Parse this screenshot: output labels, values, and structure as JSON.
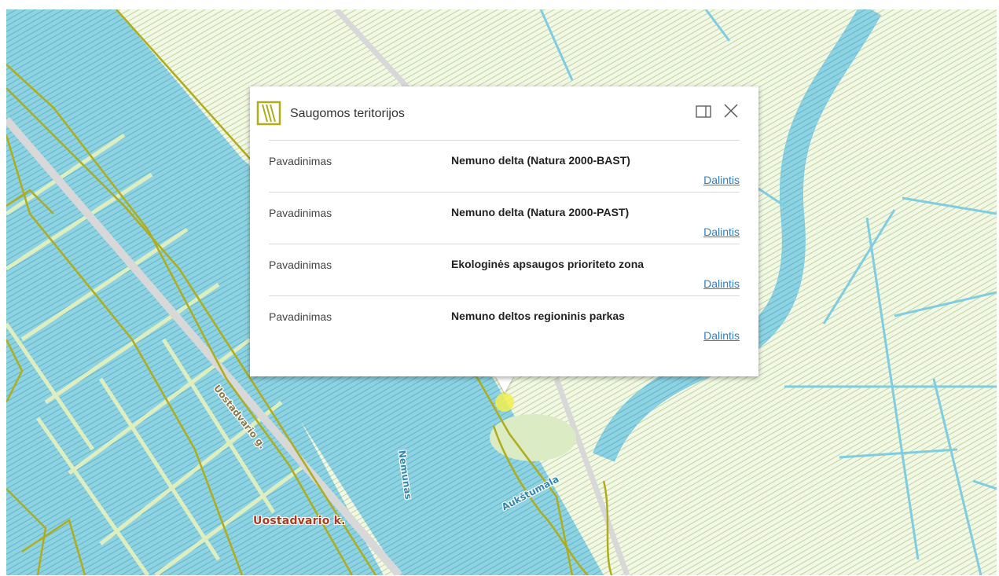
{
  "map": {
    "colors": {
      "water": "#7fcde0",
      "land": "#e8f2cf",
      "boundary": "#b0ac1a",
      "road": "#d4d4d4",
      "highlight": "#f2ee4f"
    },
    "labels": {
      "street": "Uostadvario g.",
      "village": "Uostadvario k.",
      "river": "Nemunas",
      "channel": "Aukštumala"
    }
  },
  "popup": {
    "title": "Saugomos teritorijos",
    "icon": "protected-area-layer-icon",
    "dock_icon": "dock-panel-icon",
    "close_icon": "close-icon",
    "rows": [
      {
        "label": "Pavadinimas",
        "value": "Nemuno delta (Natura 2000-BAST)",
        "share": "Dalintis"
      },
      {
        "label": "Pavadinimas",
        "value": "Nemuno delta (Natura 2000-PAST)",
        "share": "Dalintis"
      },
      {
        "label": "Pavadinimas",
        "value": "Ekologinės apsaugos prioriteto zona",
        "share": "Dalintis"
      },
      {
        "label": "Pavadinimas",
        "value": "Nemuno deltos regioninis parkas",
        "share": "Dalintis"
      }
    ]
  }
}
